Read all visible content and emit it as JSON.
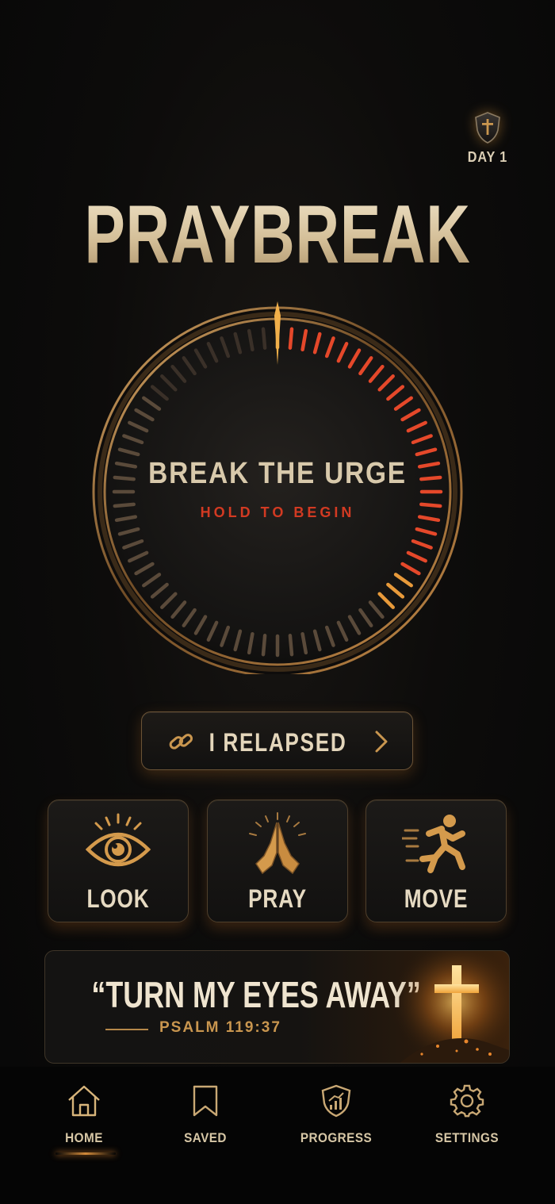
{
  "header": {
    "day_label": "DAY 1",
    "badge_icon": "shield-cross-icon"
  },
  "app": {
    "title": "PRAYBREAK"
  },
  "dial": {
    "title": "BREAK THE URGE",
    "subtitle": "HOLD TO BEGIN",
    "progress": 0.37,
    "colors": {
      "active": "#e5482a",
      "inactive": "#5a4a3a",
      "ring": "#b07a3e"
    }
  },
  "relapse": {
    "label": "I RELAPSED",
    "icon": "link-icon",
    "chevron": "chevron-right-icon"
  },
  "actions": [
    {
      "id": "look",
      "label": "LOOK",
      "icon": "eye-icon"
    },
    {
      "id": "pray",
      "label": "PRAY",
      "icon": "praying-hands-icon"
    },
    {
      "id": "move",
      "label": "MOVE",
      "icon": "running-person-icon"
    }
  ],
  "verse": {
    "quote": "“TURN MY EYES AWAY”",
    "reference": "PSALM 119:37",
    "art": "glowing-cross-icon"
  },
  "nav": {
    "items": [
      {
        "label": "HOME",
        "icon": "home-icon",
        "active": true
      },
      {
        "label": "SAVED",
        "icon": "bookmark-icon",
        "active": false
      },
      {
        "label": "PROGRESS",
        "icon": "progress-shield-icon",
        "active": false
      },
      {
        "label": "SETTINGS",
        "icon": "gear-icon",
        "active": false
      }
    ]
  },
  "colors": {
    "accent": "#c9964f",
    "alert": "#d23a22",
    "text": "#e6dac2"
  }
}
